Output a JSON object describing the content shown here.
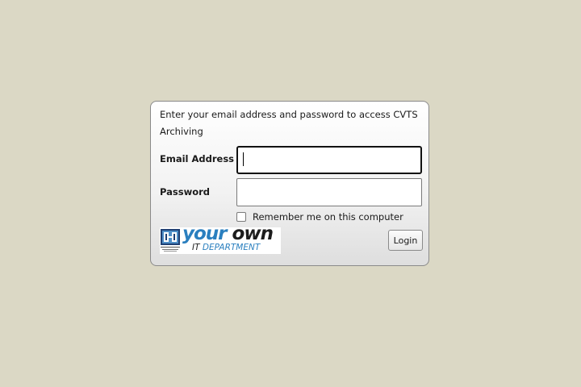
{
  "login": {
    "intro_text": "Enter your email address and password to access CVTS Archiving",
    "email_label": "Email Address",
    "email_value": "",
    "password_label": "Password",
    "password_value": "",
    "remember_label": "Remember me on this computer",
    "remember_checked": false,
    "login_button": "Login"
  },
  "logo": {
    "main_part1": "your",
    "main_part2": " own",
    "sub_part1": "IT ",
    "sub_part2": "DEPARTMENT",
    "icon": "it-department-logo-icon"
  },
  "colors": {
    "background": "#dbd8c5",
    "logo_blue": "#2a7fbf",
    "focus_border": "#111111"
  }
}
